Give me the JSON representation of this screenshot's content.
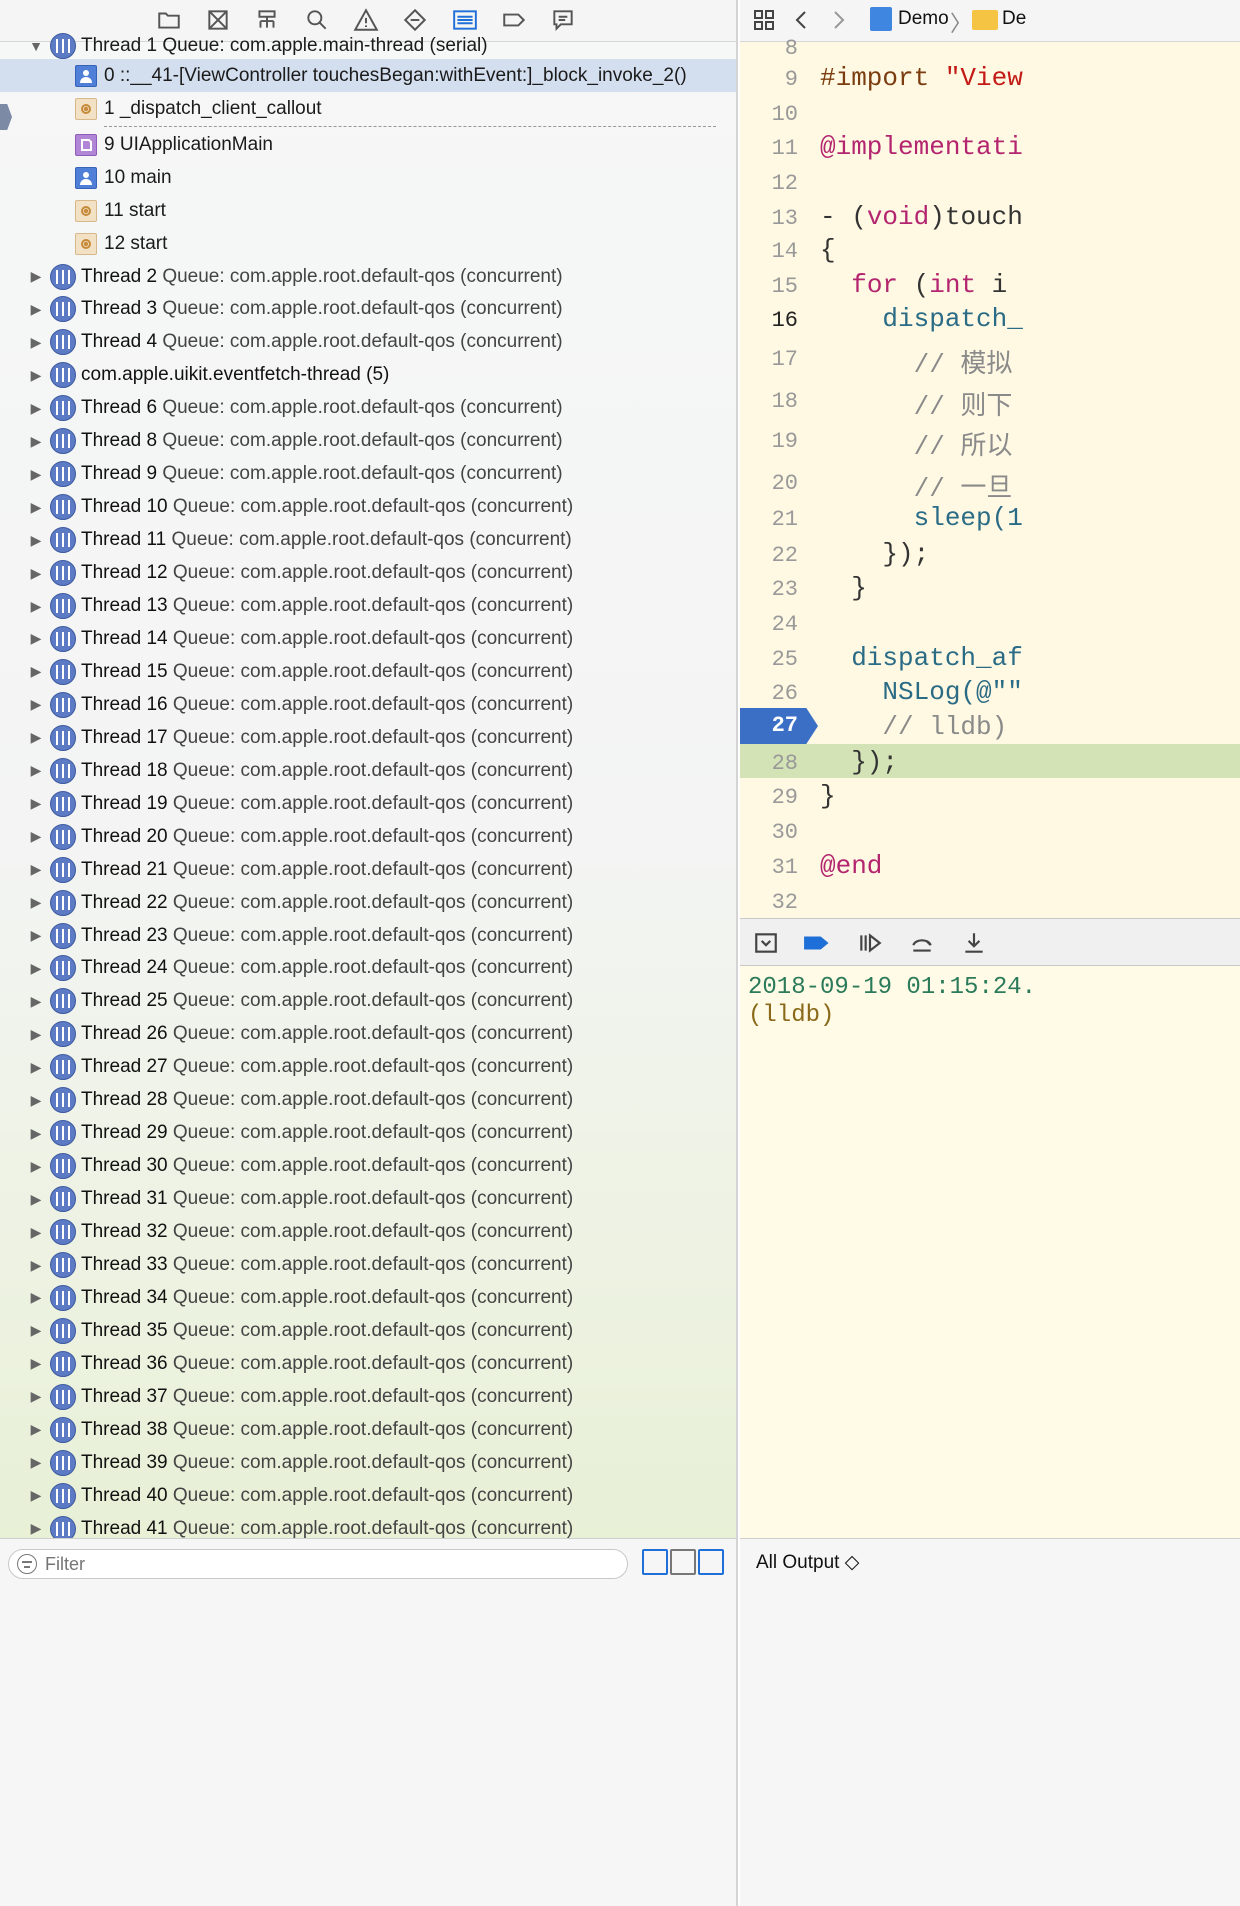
{
  "navigator": {
    "toolbar_icons": [
      "folder-icon",
      "source-control-icon",
      "hierarchy-icon",
      "search-icon",
      "warning-icon",
      "test-icon",
      "debug-icon",
      "breakpoint-icon",
      "report-icon"
    ],
    "thread1_header": "Thread 1 Queue: com.apple.main-thread (serial)",
    "frames": [
      {
        "label": "0 ::__41-[ViewController touchesBegan:withEvent:]_block_invoke_2()",
        "kind": "user"
      },
      {
        "label": "1 _dispatch_client_callout",
        "kind": "sys"
      },
      {
        "label": "9 UIApplicationMain",
        "kind": "uikit"
      },
      {
        "label": "10 main",
        "kind": "user"
      },
      {
        "label": "11 start",
        "kind": "sys"
      },
      {
        "label": "12 start",
        "kind": "sys"
      }
    ],
    "threads": [
      {
        "name": "Thread 2",
        "queue": "Queue: com.apple.root.default-qos (concurrent)"
      },
      {
        "name": "Thread 3",
        "queue": "Queue: com.apple.root.default-qos (concurrent)"
      },
      {
        "name": "Thread 4",
        "queue": "Queue: com.apple.root.default-qos (concurrent)"
      },
      {
        "name": "com.apple.uikit.eventfetch-thread (5)",
        "queue": ""
      },
      {
        "name": "Thread 6",
        "queue": "Queue: com.apple.root.default-qos (concurrent)"
      },
      {
        "name": "Thread 8",
        "queue": "Queue: com.apple.root.default-qos (concurrent)"
      },
      {
        "name": "Thread 9",
        "queue": "Queue: com.apple.root.default-qos (concurrent)"
      },
      {
        "name": "Thread 10",
        "queue": "Queue: com.apple.root.default-qos (concurrent)"
      },
      {
        "name": "Thread 11",
        "queue": "Queue: com.apple.root.default-qos (concurrent)"
      },
      {
        "name": "Thread 12",
        "queue": "Queue: com.apple.root.default-qos (concurrent)"
      },
      {
        "name": "Thread 13",
        "queue": "Queue: com.apple.root.default-qos (concurrent)"
      },
      {
        "name": "Thread 14",
        "queue": "Queue: com.apple.root.default-qos (concurrent)"
      },
      {
        "name": "Thread 15",
        "queue": "Queue: com.apple.root.default-qos (concurrent)"
      },
      {
        "name": "Thread 16",
        "queue": "Queue: com.apple.root.default-qos (concurrent)"
      },
      {
        "name": "Thread 17",
        "queue": "Queue: com.apple.root.default-qos (concurrent)"
      },
      {
        "name": "Thread 18",
        "queue": "Queue: com.apple.root.default-qos (concurrent)"
      },
      {
        "name": "Thread 19",
        "queue": "Queue: com.apple.root.default-qos (concurrent)"
      },
      {
        "name": "Thread 20",
        "queue": "Queue: com.apple.root.default-qos (concurrent)"
      },
      {
        "name": "Thread 21",
        "queue": "Queue: com.apple.root.default-qos (concurrent)"
      },
      {
        "name": "Thread 22",
        "queue": "Queue: com.apple.root.default-qos (concurrent)"
      },
      {
        "name": "Thread 23",
        "queue": "Queue: com.apple.root.default-qos (concurrent)"
      },
      {
        "name": "Thread 24",
        "queue": "Queue: com.apple.root.default-qos (concurrent)"
      },
      {
        "name": "Thread 25",
        "queue": "Queue: com.apple.root.default-qos (concurrent)"
      },
      {
        "name": "Thread 26",
        "queue": "Queue: com.apple.root.default-qos (concurrent)"
      },
      {
        "name": "Thread 27",
        "queue": "Queue: com.apple.root.default-qos (concurrent)"
      },
      {
        "name": "Thread 28",
        "queue": "Queue: com.apple.root.default-qos (concurrent)"
      },
      {
        "name": "Thread 29",
        "queue": "Queue: com.apple.root.default-qos (concurrent)"
      },
      {
        "name": "Thread 30",
        "queue": "Queue: com.apple.root.default-qos (concurrent)"
      },
      {
        "name": "Thread 31",
        "queue": "Queue: com.apple.root.default-qos (concurrent)"
      },
      {
        "name": "Thread 32",
        "queue": "Queue: com.apple.root.default-qos (concurrent)"
      },
      {
        "name": "Thread 33",
        "queue": "Queue: com.apple.root.default-qos (concurrent)"
      },
      {
        "name": "Thread 34",
        "queue": "Queue: com.apple.root.default-qos (concurrent)"
      },
      {
        "name": "Thread 35",
        "queue": "Queue: com.apple.root.default-qos (concurrent)"
      },
      {
        "name": "Thread 36",
        "queue": "Queue: com.apple.root.default-qos (concurrent)"
      },
      {
        "name": "Thread 37",
        "queue": "Queue: com.apple.root.default-qos (concurrent)"
      },
      {
        "name": "Thread 38",
        "queue": "Queue: com.apple.root.default-qos (concurrent)"
      },
      {
        "name": "Thread 39",
        "queue": "Queue: com.apple.root.default-qos (concurrent)"
      },
      {
        "name": "Thread 40",
        "queue": "Queue: com.apple.root.default-qos (concurrent)"
      },
      {
        "name": "Thread 41",
        "queue": "Queue: com.apple.root.default-qos (concurrent)"
      }
    ],
    "filter_placeholder": "Filter"
  },
  "editor": {
    "breadcrumb": [
      "Demo",
      "De"
    ],
    "breakpoint_line": "27",
    "lines": [
      {
        "num": "8",
        "code": ""
      },
      {
        "num": "9",
        "code": "#import \"View"
      },
      {
        "num": "10",
        "code": ""
      },
      {
        "num": "11",
        "code": "@implementati"
      },
      {
        "num": "12",
        "code": ""
      },
      {
        "num": "13",
        "code": "- (void)touch"
      },
      {
        "num": "14",
        "code": "{"
      },
      {
        "num": "15",
        "code": "  for (int i"
      },
      {
        "num": "16",
        "code": "    dispatch_"
      },
      {
        "num": "17",
        "code": "      // 模拟"
      },
      {
        "num": "18",
        "code": "      // 则下"
      },
      {
        "num": "19",
        "code": "      // 所以"
      },
      {
        "num": "20",
        "code": "      // 一旦"
      },
      {
        "num": "21",
        "code": "      sleep(1"
      },
      {
        "num": "22",
        "code": "    });"
      },
      {
        "num": "23",
        "code": "  }"
      },
      {
        "num": "24",
        "code": ""
      },
      {
        "num": "25",
        "code": "  dispatch_af"
      },
      {
        "num": "26",
        "code": "    NSLog(@\"\""
      },
      {
        "num": "27",
        "code": "    // lldb)"
      },
      {
        "num": "28",
        "code": "  });"
      },
      {
        "num": "29",
        "code": "}"
      },
      {
        "num": "30",
        "code": ""
      },
      {
        "num": "31",
        "code": "@end"
      },
      {
        "num": "32",
        "code": ""
      }
    ]
  },
  "console": {
    "log_line": "2018-09-19 01:15:24.",
    "prompt": "(lldb)",
    "output_select": "All Output ◇"
  },
  "colors": {
    "accent": "#1f6fd8",
    "breakpoint": "#3b6fc6",
    "pc_line": "#d3e3b5",
    "keyword": "#b3256f",
    "selection": "#d3deee"
  }
}
